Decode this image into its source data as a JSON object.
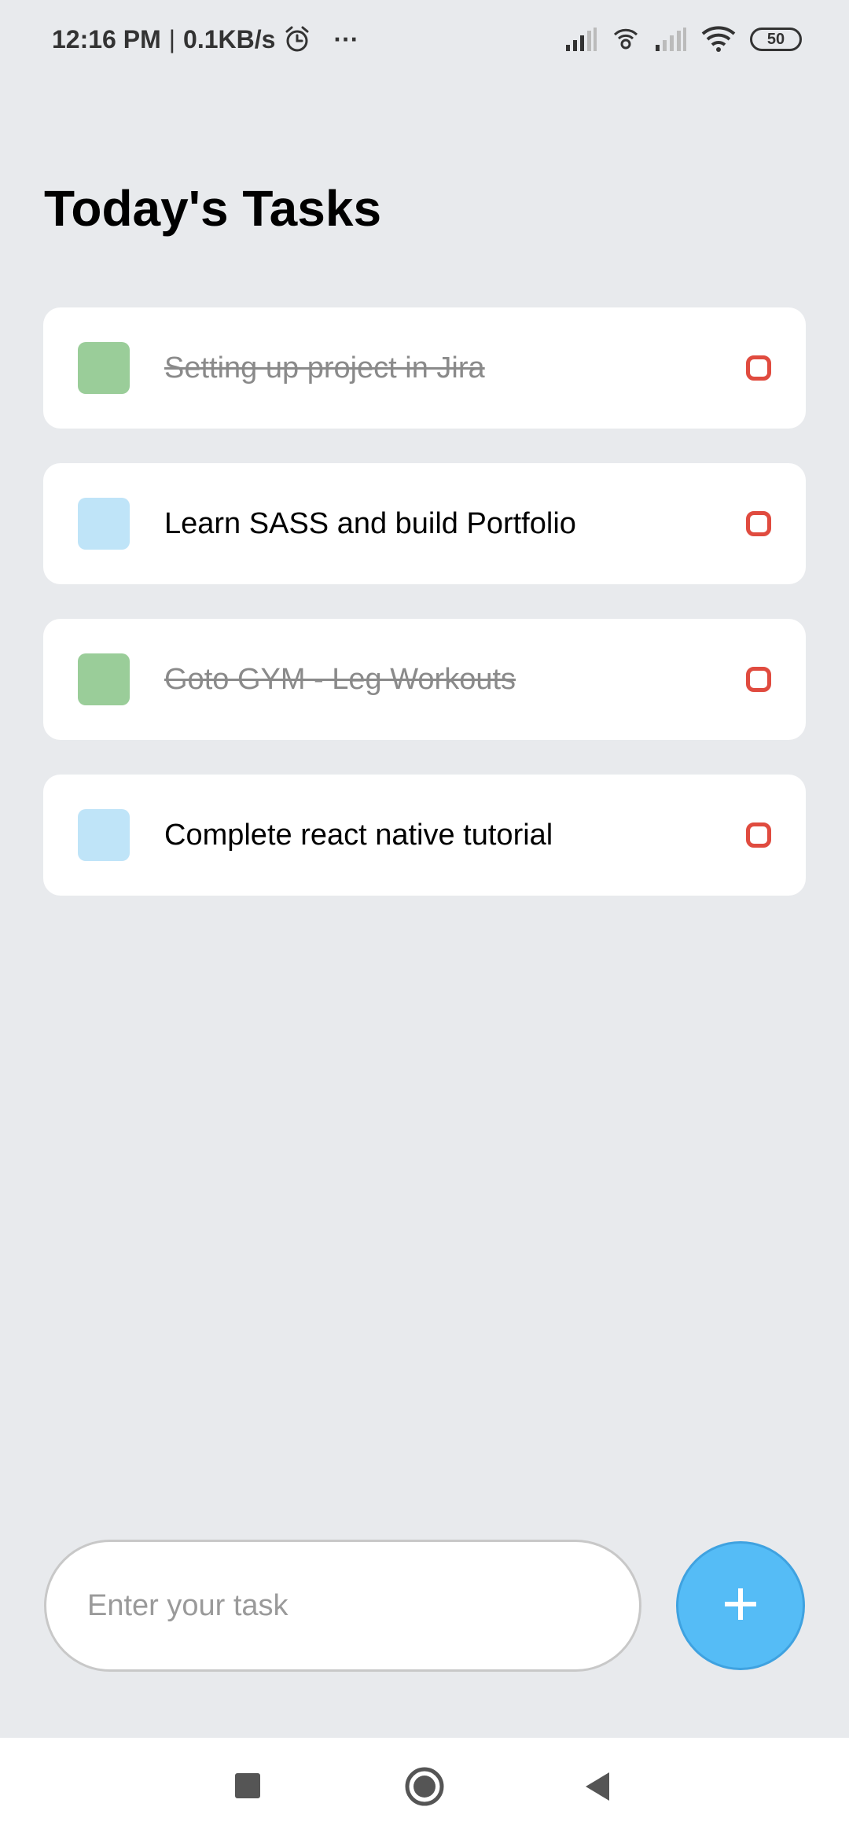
{
  "status_bar": {
    "time": "12:16 PM",
    "separator": "|",
    "speed": "0.1KB/s",
    "more": "···",
    "battery": "50"
  },
  "page": {
    "title": "Today's Tasks"
  },
  "tasks": [
    {
      "text": "Setting up project in Jira",
      "completed": true,
      "square_color": "#9ACD99"
    },
    {
      "text": "Learn SASS and build Portfolio",
      "completed": false,
      "square_color": "#BFE4F8"
    },
    {
      "text": "Goto GYM - Leg Workouts",
      "completed": true,
      "square_color": "#9ACD99"
    },
    {
      "text": "Complete react native tutorial",
      "completed": false,
      "square_color": "#BFE4F8"
    }
  ],
  "input": {
    "placeholder": "Enter your task",
    "value": ""
  },
  "add_button": {
    "icon": "plus-icon",
    "color": "#55BCF6"
  },
  "nav": {
    "recents": "square-icon",
    "home": "circle-icon",
    "back": "triangle-back-icon"
  },
  "colors": {
    "background": "#E8EAED",
    "delete_circle": "#E04B3F"
  }
}
